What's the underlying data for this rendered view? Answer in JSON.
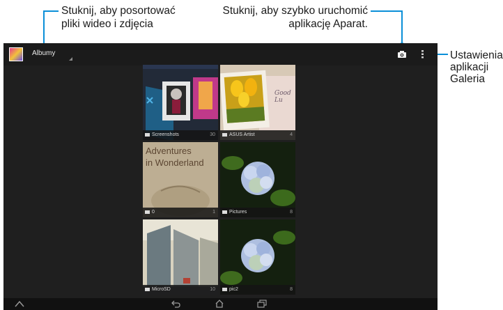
{
  "annotations": {
    "left_line1": "Stuknij, aby posortować",
    "left_line2": "pliki wideo i zdjęcia",
    "mid_line1": "Stuknij, aby szybko uruchomić",
    "mid_line2": "aplikację Aparat.",
    "right_line1": "Ustawienia",
    "right_line2": "aplikacji",
    "right_line3": "Galeria",
    "accent_color": "#0a8fd8"
  },
  "action_bar": {
    "app_icon": "gallery-app-icon",
    "spinner_label": "Albumy",
    "camera_icon": "camera-icon",
    "menu_icon": "overflow-menu-icon"
  },
  "albums": [
    {
      "name": "Screenshots",
      "count": "30"
    },
    {
      "name": "ASUS Artist",
      "count": "4"
    },
    {
      "name": "0",
      "count": "1"
    },
    {
      "name": "Pictures",
      "count": "8"
    },
    {
      "name": "MicroSD",
      "count": "10"
    },
    {
      "name": "pic2",
      "count": "8"
    }
  ],
  "album_thumbnail_text": {
    "adventures_line1": "Adventures",
    "adventures_line2": "in Wonderland",
    "card_text": "Good Lu"
  },
  "nav_bar": {
    "icons": [
      "chevron-up-icon",
      "back-icon",
      "home-icon",
      "recent-apps-icon"
    ]
  }
}
